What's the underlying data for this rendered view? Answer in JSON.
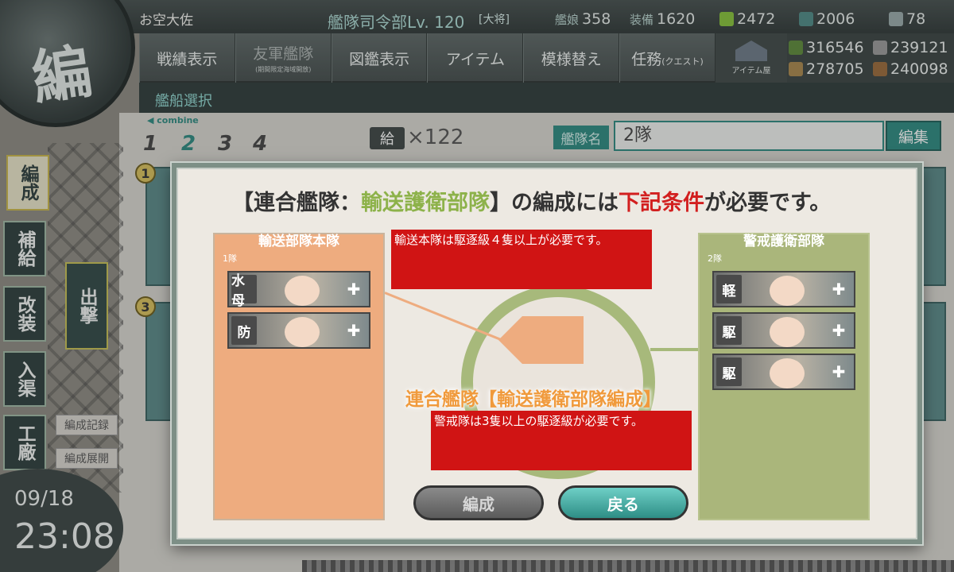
{
  "topbar": {
    "player_rank": "お空大佐",
    "hq_label": "艦隊司令部Lv.",
    "hq_level": "120",
    "hq_rank": "[大将]",
    "ships_label": "艦娘",
    "ships_count": "358",
    "equip_label": "装備",
    "equip_count": "1620",
    "bucket_count": "2472",
    "build_count": "2006",
    "devmat_count": "78"
  },
  "menu": {
    "items": [
      {
        "label": "戦績表示",
        "sub": ""
      },
      {
        "label": "友軍艦隊",
        "sub": "(期間限定海域開放)"
      },
      {
        "label": "図鑑表示",
        "sub": ""
      },
      {
        "label": "アイテム",
        "sub": ""
      },
      {
        "label": "模様替え",
        "sub": ""
      },
      {
        "label": "任務",
        "sub": "(クエスト)"
      }
    ],
    "item_shop": "アイテム屋"
  },
  "materials": {
    "fuel": "316546",
    "ammo": "239121",
    "steel": "278705",
    "bauxite": "240098"
  },
  "emblem_text": "編",
  "subheader": {
    "title": "艦船選択"
  },
  "sidebar": {
    "buttons": [
      "編成",
      "補給",
      "改装",
      "入渠",
      "工廠"
    ],
    "big_button": "出撃",
    "record": "編成記録",
    "expand": "編成展開"
  },
  "clock": {
    "date": "09/18",
    "time": "23:08"
  },
  "fleet": {
    "combine_label": "◀ combine",
    "tabs": [
      "1",
      "2",
      "3",
      "4"
    ],
    "active_tab": 1,
    "supply_label": "給",
    "supply_count": "×122",
    "name_label": "艦隊名",
    "name_value": "2隊",
    "edit_label": "編集"
  },
  "background_cards": {
    "num_1": "1",
    "num_3": "3"
  },
  "dialog": {
    "title_open": "【連合艦隊：",
    "title_green": "輸送護衛部隊",
    "title_mid": "】の編成には",
    "title_red": "下記条件",
    "title_end": "が必要です。",
    "left_panel": {
      "header": "輸送部隊本隊",
      "sub": "1隊",
      "ships": [
        {
          "tag": "水母"
        },
        {
          "tag": "防"
        }
      ]
    },
    "right_panel": {
      "header": "警戒護衛部隊",
      "sub": "2隊",
      "ships": [
        {
          "tag": "軽"
        },
        {
          "tag": "駆"
        },
        {
          "tag": "駆"
        }
      ]
    },
    "req_left": "輸送本隊は駆逐級４隻以上が必要です。",
    "req_right": "警戒隊は3隻以上の駆逐級が必要です。",
    "center_label": "連合艦隊【輸送護衛部隊編成】",
    "button_form": "編成",
    "button_back": "戻る"
  },
  "colors": {
    "accent": "#2d8a80",
    "transport": "#eeac7f",
    "escort": "#a7b97b",
    "warning": "#d01414"
  }
}
